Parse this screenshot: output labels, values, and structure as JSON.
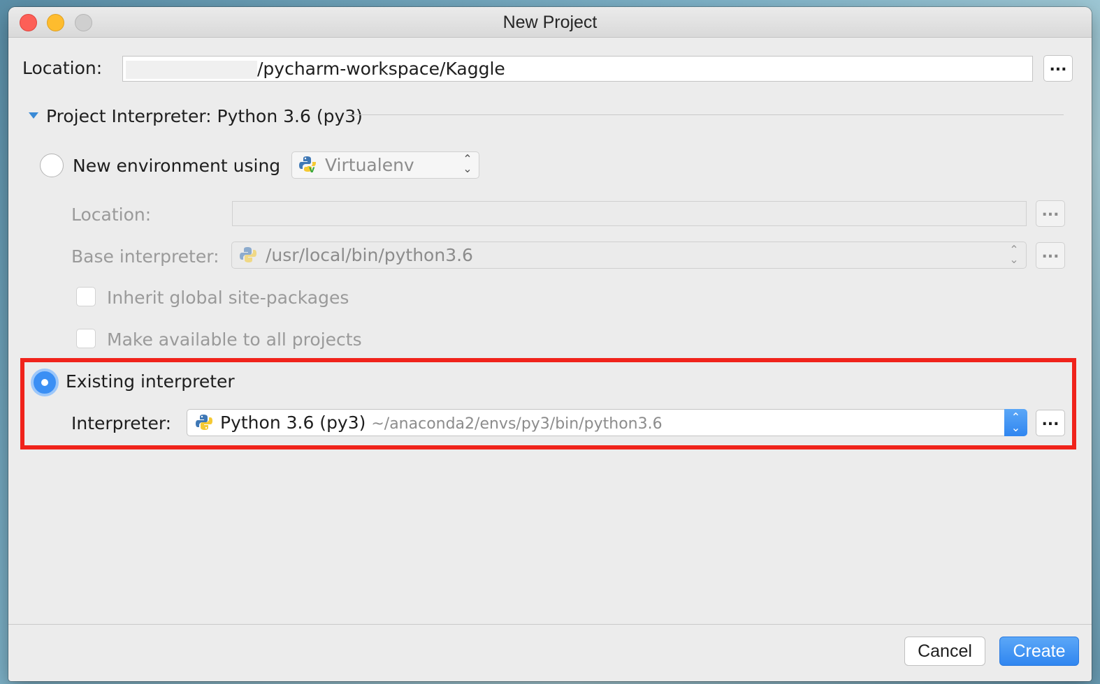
{
  "window": {
    "title": "New Project"
  },
  "location": {
    "label": "Location:",
    "value": "/pycharm-workspace/Kaggle",
    "browse_label": "..."
  },
  "interpreter_section": {
    "label": "Project Interpreter: Python 3.6 (py3)"
  },
  "new_env": {
    "radio_label": "New environment using",
    "tool": "Virtualenv",
    "location_label": "Location:",
    "location_value": "",
    "base_label": "Base interpreter:",
    "base_value": "/usr/local/bin/python3.6",
    "inherit_label": "Inherit global site-packages",
    "available_label": "Make available to all projects",
    "browse_label": "..."
  },
  "existing": {
    "radio_label": "Existing interpreter",
    "interpreter_label": "Interpreter:",
    "interpreter_name": "Python 3.6 (py3)",
    "interpreter_path": "~/anaconda2/envs/py3/bin/python3.6",
    "browse_label": "..."
  },
  "footer": {
    "cancel_label": "Cancel",
    "create_label": "Create"
  },
  "colors": {
    "accent": "#3b8ff4",
    "highlight_box": "#f0231b"
  },
  "icons": [
    "python-icon",
    "virtualenv-icon",
    "disclosure-triangle-icon",
    "stepper-icon"
  ]
}
